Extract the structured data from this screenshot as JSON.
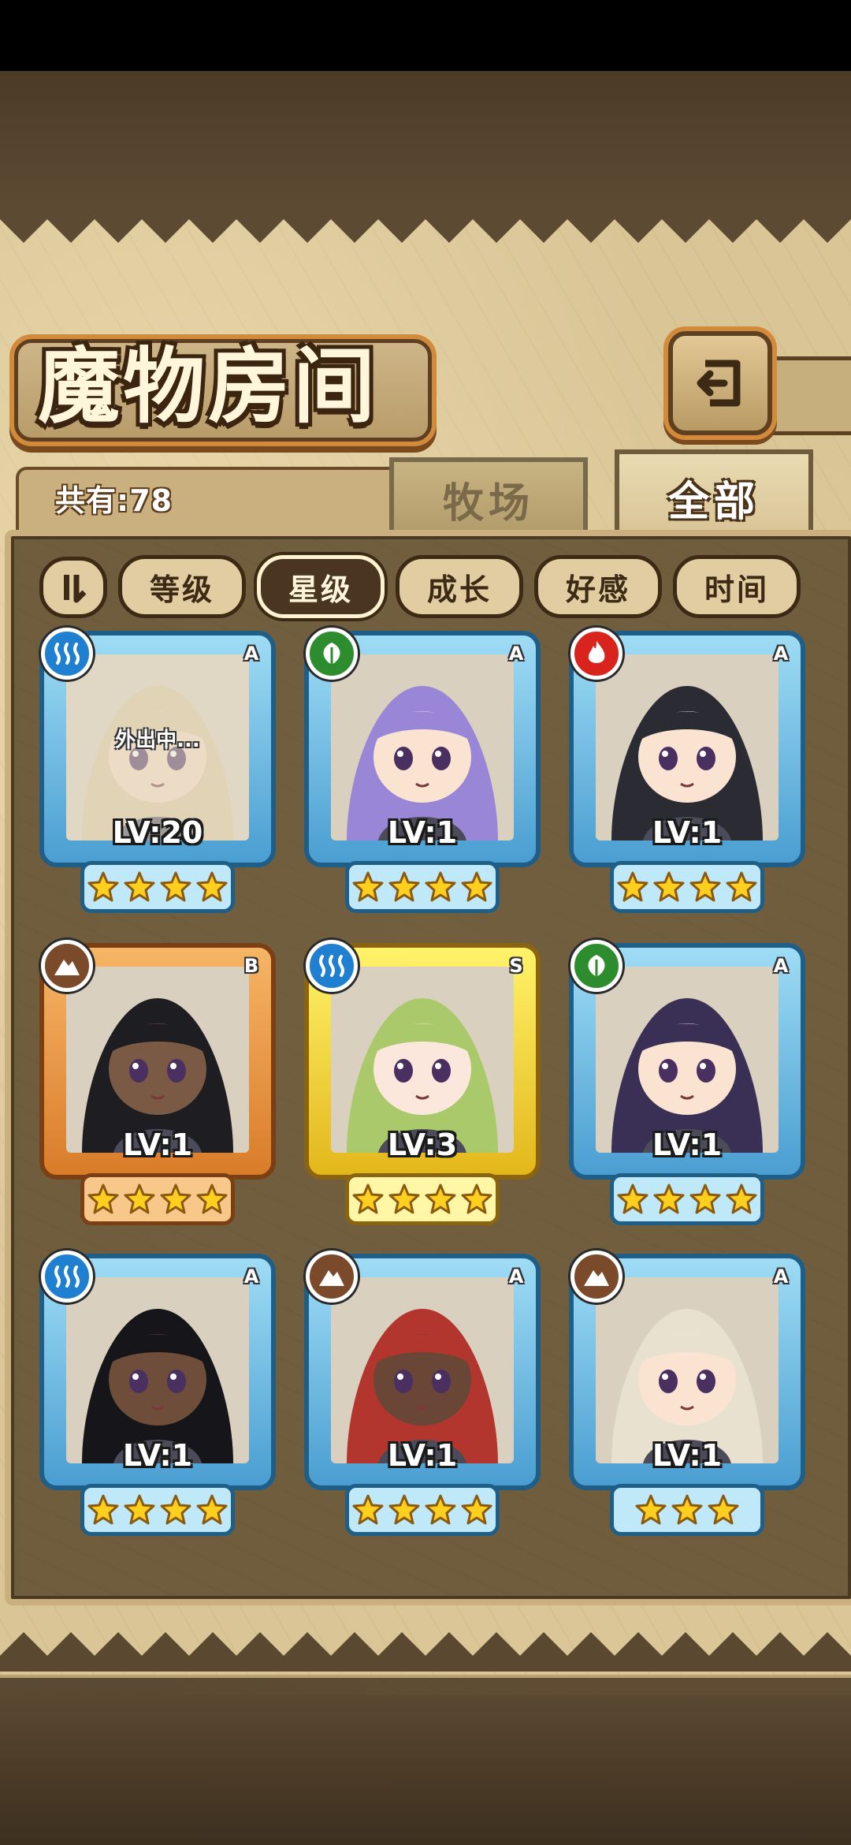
{
  "title": "魔物房间",
  "count_text": "共有:78",
  "tabs": {
    "farm": "牧场",
    "all": "全部",
    "active": "all"
  },
  "sort_buttons": [
    {
      "label": "等级",
      "active": false
    },
    {
      "label": "星级",
      "active": true
    },
    {
      "label": "成长",
      "active": false
    },
    {
      "label": "好感",
      "active": false
    },
    {
      "label": "时间",
      "active": false
    }
  ],
  "icons": {
    "back": "back-arrow-icon",
    "sort_toggle": "sort-order-icon",
    "water": "water-element-icon",
    "nature": "leaf-element-icon",
    "fire": "fire-element-icon",
    "earth": "mountain-element-icon",
    "star": "star-icon"
  },
  "colors": {
    "water": "#1f7fd0",
    "nature": "#2d8d2e",
    "fire": "#d8241c",
    "earth": "#7a4a2a",
    "rarity_A": "#4a9ed1",
    "rarity_S": "#e3b71b",
    "rarity_B": "#d97c2a"
  },
  "monsters": [
    {
      "element": "water",
      "rarity": "A",
      "level": "LV:20",
      "stars": 4,
      "status": "外出中...",
      "hair": "#d9c7a0",
      "skin": "#f3dcc4"
    },
    {
      "element": "nature",
      "rarity": "A",
      "level": "LV:1",
      "stars": 4,
      "status": "",
      "hair": "#9a86d6",
      "skin": "#fbe3d2"
    },
    {
      "element": "fire",
      "rarity": "A",
      "level": "LV:1",
      "stars": 4,
      "status": "",
      "hair": "#2b2b33",
      "skin": "#fbe3d2"
    },
    {
      "element": "earth",
      "rarity": "B",
      "level": "LV:1",
      "stars": 4,
      "status": "",
      "hair": "#1e1e22",
      "skin": "#7a5a44"
    },
    {
      "element": "water",
      "rarity": "S",
      "level": "LV:3",
      "stars": 4,
      "status": "",
      "hair": "#a9c96a",
      "skin": "#fbe7dc"
    },
    {
      "element": "nature",
      "rarity": "A",
      "level": "LV:1",
      "stars": 4,
      "status": "",
      "hair": "#3a2f55",
      "skin": "#fbe3d2"
    },
    {
      "element": "water",
      "rarity": "A",
      "level": "LV:1",
      "stars": 4,
      "status": "",
      "hair": "#16161a",
      "skin": "#6e4e3a"
    },
    {
      "element": "earth",
      "rarity": "A",
      "level": "LV:1",
      "stars": 4,
      "status": "",
      "hair": "#b3362e",
      "skin": "#6a4636"
    },
    {
      "element": "earth",
      "rarity": "A",
      "level": "LV:1",
      "stars": 3,
      "status": "",
      "hair": "#e8e1cf",
      "skin": "#fbe3d2"
    }
  ]
}
